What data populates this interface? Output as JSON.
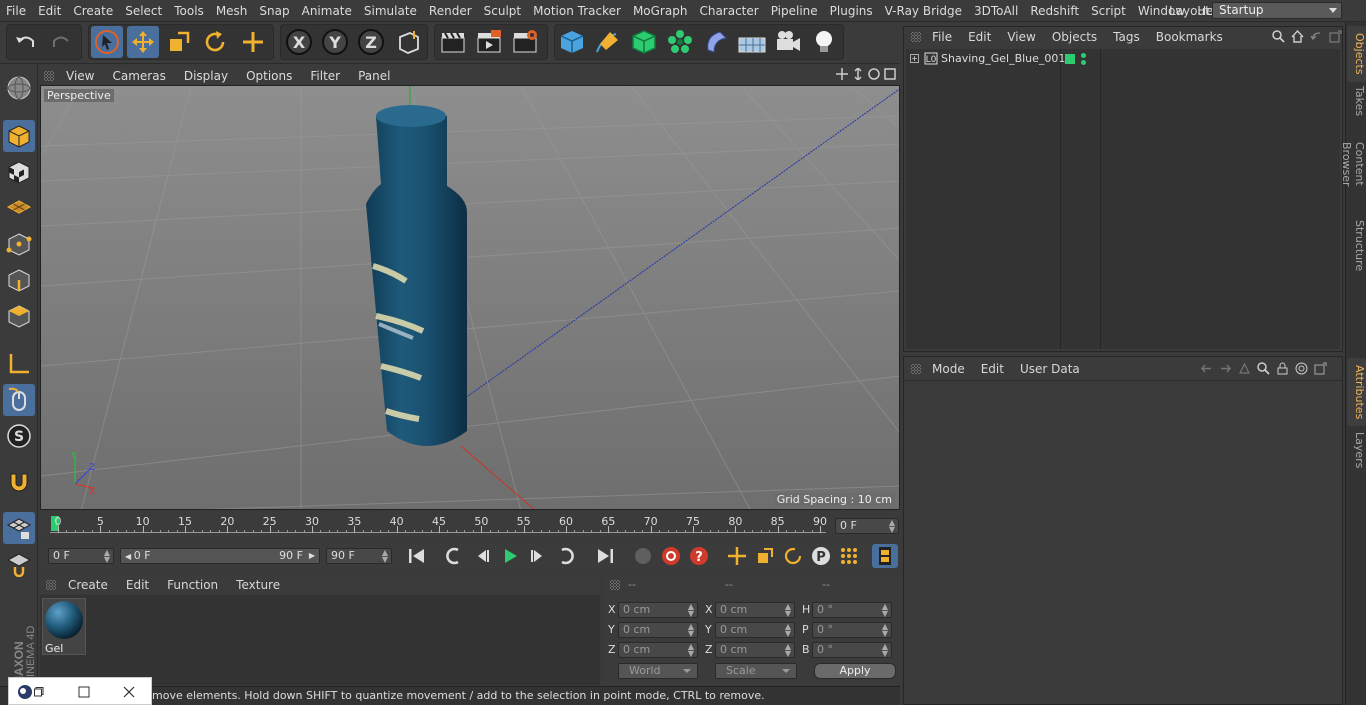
{
  "menubar": {
    "items": [
      "File",
      "Edit",
      "Create",
      "Select",
      "Tools",
      "Mesh",
      "Snap",
      "Animate",
      "Simulate",
      "Render",
      "Sculpt",
      "Motion Tracker",
      "MoGraph",
      "Character",
      "Pipeline",
      "Plugins",
      "V-Ray Bridge",
      "3DToAll",
      "Redshift",
      "Script",
      "Window",
      "Help"
    ],
    "layout_label": "Layout:",
    "layout_value": "Startup"
  },
  "viewport": {
    "menu": [
      "View",
      "Cameras",
      "Display",
      "Options",
      "Filter",
      "Panel"
    ],
    "label": "Perspective",
    "grid_spacing": "Grid Spacing : 10 cm"
  },
  "timeline": {
    "ticks": [
      "0",
      "5",
      "10",
      "15",
      "20",
      "25",
      "30",
      "35",
      "40",
      "45",
      "50",
      "55",
      "60",
      "65",
      "70",
      "75",
      "80",
      "85",
      "90"
    ],
    "current_frame": "0 F"
  },
  "anim": {
    "start": "0 F",
    "range_start": "0 F",
    "range_end": "90 F",
    "end": "90 F"
  },
  "material": {
    "menu": [
      "Create",
      "Edit",
      "Function",
      "Texture"
    ],
    "name": "Gel"
  },
  "coords": {
    "headers": [
      "--",
      "--",
      "--"
    ],
    "rows": [
      {
        "a": "X",
        "av": "0 cm",
        "b": "X",
        "bv": "0 cm",
        "c": "H",
        "cv": "0 °"
      },
      {
        "a": "Y",
        "av": "0 cm",
        "b": "Y",
        "bv": "0 cm",
        "c": "P",
        "cv": "0 °"
      },
      {
        "a": "Z",
        "av": "0 cm",
        "b": "Z",
        "bv": "0 cm",
        "c": "B",
        "cv": "0 °"
      }
    ],
    "mode_world": "World",
    "mode_scale": "Scale",
    "apply": "Apply"
  },
  "objects": {
    "menu": [
      "File",
      "Edit",
      "View",
      "Objects",
      "Tags",
      "Bookmarks"
    ],
    "items": [
      {
        "name": "Shaving_Gel_Blue_001"
      }
    ]
  },
  "attributes": {
    "menu": [
      "Mode",
      "Edit",
      "User Data"
    ]
  },
  "right_tabs": [
    "Objects",
    "Takes",
    "Content Browser",
    "Structure",
    "Attributes",
    "Layers"
  ],
  "status": "move elements. Hold down SHIFT to quantize movement / add to the selection in point mode, CTRL to remove.",
  "brand": {
    "maxon": "MAXON",
    "cinema": "CINEMA 4D"
  },
  "colors": {
    "accent": "#4a6f9c",
    "bottle": "#1f5a7a",
    "tab_active": "#f0b45a",
    "green_tag": "#2ecc71"
  }
}
